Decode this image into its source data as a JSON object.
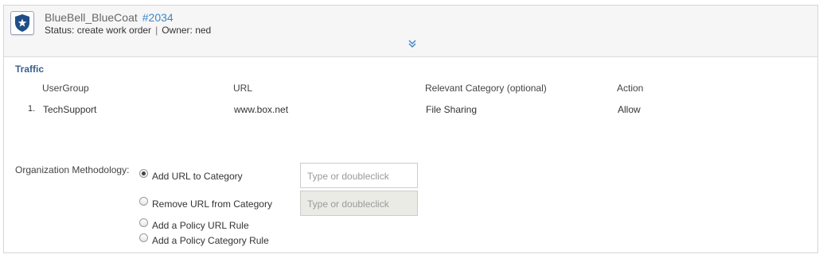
{
  "header": {
    "title": "BlueBell_BlueCoat",
    "ticket": "#2034",
    "status": "Status: create work order",
    "separator": "|",
    "owner": "Owner: ned"
  },
  "traffic": {
    "title": "Traffic",
    "columns": [
      "UserGroup",
      "URL",
      "Relevant Category (optional)",
      "Action"
    ],
    "rows": [
      {
        "num": "1.",
        "usergroup": "TechSupport",
        "url": "www.box.net",
        "category": "File Sharing",
        "action": "Allow"
      }
    ]
  },
  "methodology": {
    "label": "Organization Methodology:",
    "options": [
      {
        "label": "Add URL to Category",
        "checked": true
      },
      {
        "label": "Remove URL from Category",
        "checked": false
      },
      {
        "label": "Add a Policy URL Rule",
        "checked": false
      },
      {
        "label": "Add a Policy Category Rule",
        "checked": false
      }
    ],
    "add_input_placeholder": "Type or doubleclick",
    "remove_input_placeholder": "Type or doubleclick"
  },
  "colors": {
    "accent": "#3f88c5",
    "section_title": "#3a5f8f",
    "icon_badge": "#1f4e87"
  },
  "icons": [
    "shield-star-icon",
    "double-chevron-down-icon"
  ]
}
